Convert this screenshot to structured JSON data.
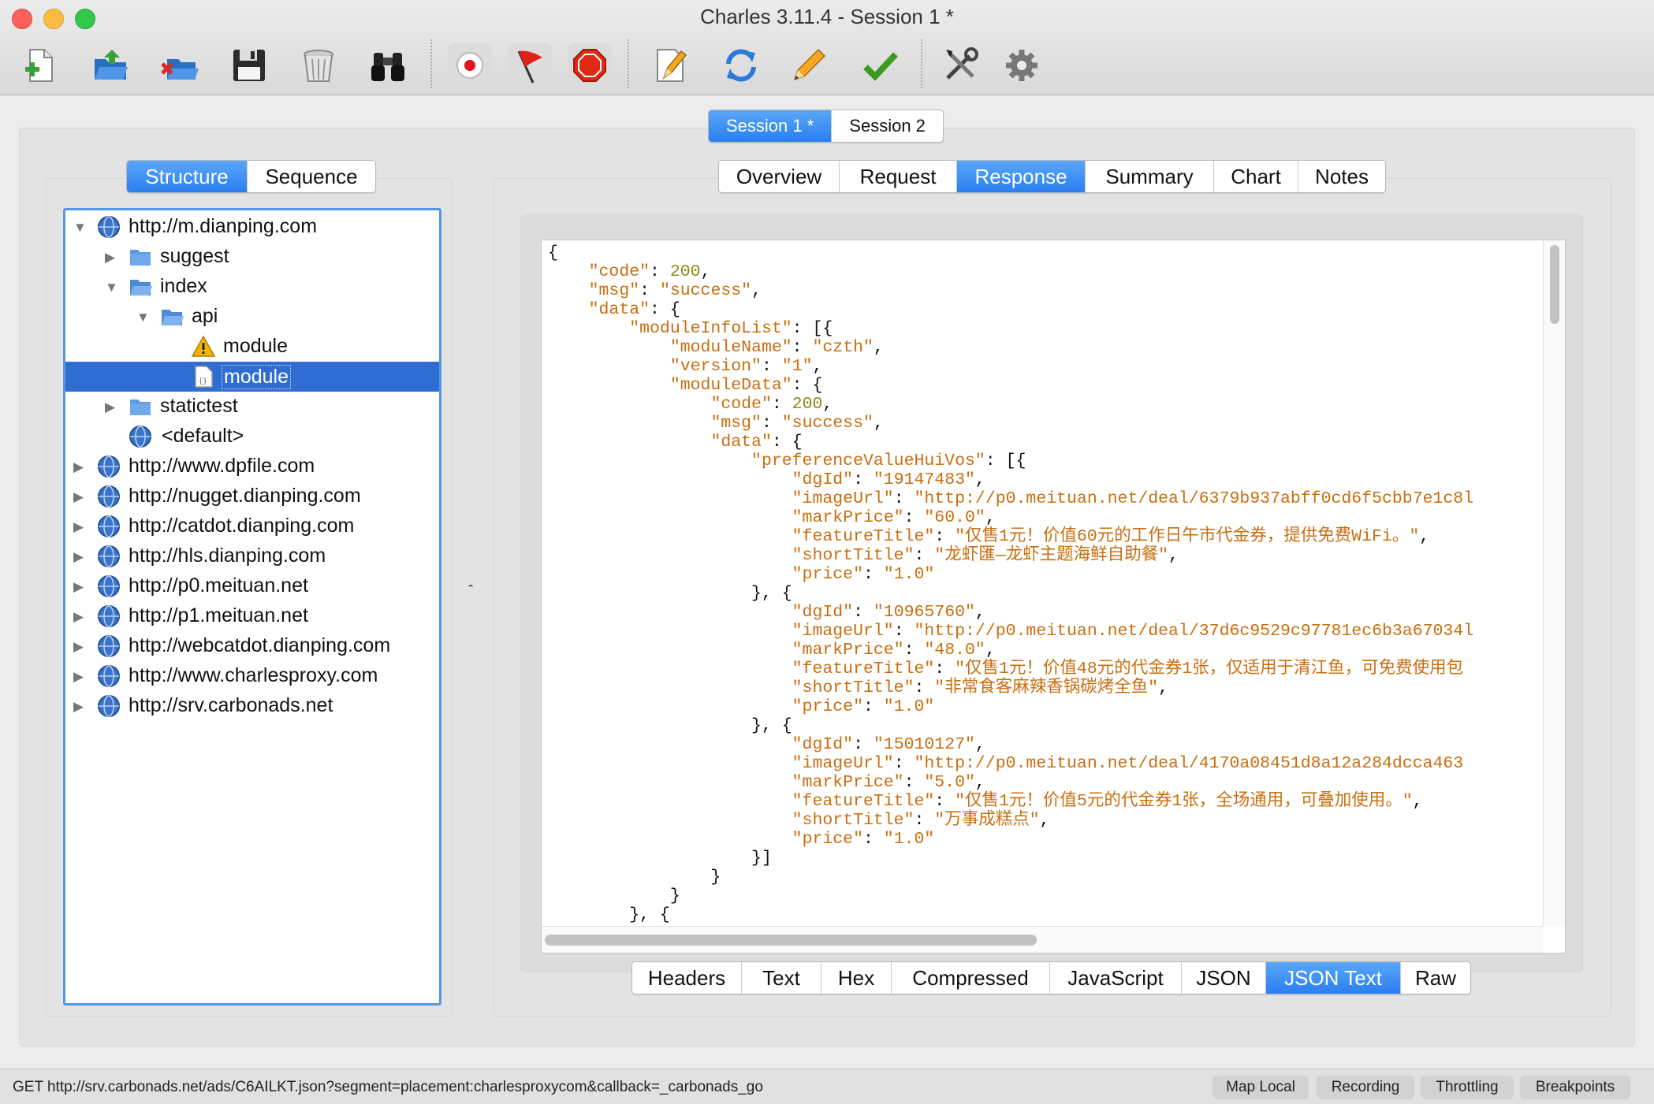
{
  "window": {
    "title": "Charles 3.11.4 - Session 1 *",
    "traffic_lights": {
      "close": "#fc605b",
      "minimize": "#fdbc40",
      "zoom": "#34c84a"
    }
  },
  "toolbar": {
    "buttons": [
      {
        "name": "new-session",
        "icon": "new-document-plus-icon"
      },
      {
        "name": "open-session",
        "icon": "open-folder-icon"
      },
      {
        "name": "close-session",
        "icon": "close-folder-icon"
      },
      {
        "name": "save-session",
        "icon": "floppy-disk-icon"
      },
      {
        "name": "clear-session",
        "icon": "trash-can-icon"
      },
      {
        "name": "find",
        "icon": "binoculars-icon"
      },
      {
        "name": "record",
        "icon": "record-icon"
      },
      {
        "name": "breakpoints",
        "icon": "red-flag-icon"
      },
      {
        "name": "throttle",
        "icon": "stop-sign-icon"
      },
      {
        "name": "compose",
        "icon": "compose-pencil-icon"
      },
      {
        "name": "repeat",
        "icon": "refresh-icon"
      },
      {
        "name": "edit",
        "icon": "pencil-icon"
      },
      {
        "name": "validate",
        "icon": "checkmark-icon"
      },
      {
        "name": "tools",
        "icon": "tools-icon"
      },
      {
        "name": "settings",
        "icon": "gear-icon"
      }
    ]
  },
  "session_tabs": [
    {
      "label": "Session 1 *",
      "selected": true
    },
    {
      "label": "Session 2",
      "selected": false
    }
  ],
  "view_tabs": [
    {
      "label": "Structure",
      "selected": true
    },
    {
      "label": "Sequence",
      "selected": false
    }
  ],
  "tree": [
    {
      "label": "http://m.dianping.com",
      "level": 0,
      "expanded": true,
      "icon": "globe-icon"
    },
    {
      "label": "suggest",
      "level": 1,
      "expanded": false,
      "icon": "folder-icon"
    },
    {
      "label": "index",
      "level": 1,
      "expanded": true,
      "icon": "folder-open-icon"
    },
    {
      "label": "api",
      "level": 2,
      "expanded": true,
      "icon": "folder-open-icon"
    },
    {
      "label": "module",
      "level": 3,
      "icon": "warning-icon"
    },
    {
      "label": "module",
      "level": 3,
      "icon": "json-file-icon",
      "selected": true
    },
    {
      "label": "statictest",
      "level": 1,
      "expanded": false,
      "icon": "folder-icon"
    },
    {
      "label": "<default>",
      "level": 1,
      "icon": "globe-icon"
    },
    {
      "label": "http://www.dpfile.com",
      "level": 0,
      "expanded": false,
      "icon": "globe-icon"
    },
    {
      "label": "http://nugget.dianping.com",
      "level": 0,
      "expanded": false,
      "icon": "globe-icon"
    },
    {
      "label": "http://catdot.dianping.com",
      "level": 0,
      "expanded": false,
      "icon": "globe-icon"
    },
    {
      "label": "http://hls.dianping.com",
      "level": 0,
      "expanded": false,
      "icon": "globe-icon"
    },
    {
      "label": "http://p0.meituan.net",
      "level": 0,
      "expanded": false,
      "icon": "globe-icon"
    },
    {
      "label": "http://p1.meituan.net",
      "level": 0,
      "expanded": false,
      "icon": "globe-icon"
    },
    {
      "label": "http://webcatdot.dianping.com",
      "level": 0,
      "expanded": false,
      "icon": "globe-icon"
    },
    {
      "label": "http://www.charlesproxy.com",
      "level": 0,
      "expanded": false,
      "icon": "globe-icon"
    },
    {
      "label": "http://srv.carbonads.net",
      "level": 0,
      "expanded": false,
      "icon": "globe-icon"
    }
  ],
  "detail_tabs": [
    {
      "label": "Overview",
      "selected": false
    },
    {
      "label": "Request",
      "selected": false
    },
    {
      "label": "Response",
      "selected": true
    },
    {
      "label": "Summary",
      "selected": false
    },
    {
      "label": "Chart",
      "selected": false
    },
    {
      "label": "Notes",
      "selected": false
    }
  ],
  "body_tabs": [
    {
      "label": "Headers",
      "selected": false
    },
    {
      "label": "Text",
      "selected": false
    },
    {
      "label": "Hex",
      "selected": false
    },
    {
      "label": "Compressed",
      "selected": false
    },
    {
      "label": "JavaScript",
      "selected": false
    },
    {
      "label": "JSON",
      "selected": false
    },
    {
      "label": "JSON Text",
      "selected": true
    },
    {
      "label": "Raw",
      "selected": false
    }
  ],
  "json_lines": [
    [
      {
        "t": "p",
        "v": "{"
      }
    ],
    [
      {
        "t": "p",
        "v": "    "
      },
      {
        "t": "k",
        "v": "\"code\""
      },
      {
        "t": "p",
        "v": ": "
      },
      {
        "t": "n",
        "v": "200"
      },
      {
        "t": "p",
        "v": ","
      }
    ],
    [
      {
        "t": "p",
        "v": "    "
      },
      {
        "t": "k",
        "v": "\"msg\""
      },
      {
        "t": "p",
        "v": ": "
      },
      {
        "t": "s",
        "v": "\"success\""
      },
      {
        "t": "p",
        "v": ","
      }
    ],
    [
      {
        "t": "p",
        "v": "    "
      },
      {
        "t": "k",
        "v": "\"data\""
      },
      {
        "t": "p",
        "v": ": {"
      }
    ],
    [
      {
        "t": "p",
        "v": "        "
      },
      {
        "t": "k",
        "v": "\"moduleInfoList\""
      },
      {
        "t": "p",
        "v": ": [{"
      }
    ],
    [
      {
        "t": "p",
        "v": "            "
      },
      {
        "t": "k",
        "v": "\"moduleName\""
      },
      {
        "t": "p",
        "v": ": "
      },
      {
        "t": "s",
        "v": "\"czth\""
      },
      {
        "t": "p",
        "v": ","
      }
    ],
    [
      {
        "t": "p",
        "v": "            "
      },
      {
        "t": "k",
        "v": "\"version\""
      },
      {
        "t": "p",
        "v": ": "
      },
      {
        "t": "s",
        "v": "\"1\""
      },
      {
        "t": "p",
        "v": ","
      }
    ],
    [
      {
        "t": "p",
        "v": "            "
      },
      {
        "t": "k",
        "v": "\"moduleData\""
      },
      {
        "t": "p",
        "v": ": {"
      }
    ],
    [
      {
        "t": "p",
        "v": "                "
      },
      {
        "t": "k",
        "v": "\"code\""
      },
      {
        "t": "p",
        "v": ": "
      },
      {
        "t": "n",
        "v": "200"
      },
      {
        "t": "p",
        "v": ","
      }
    ],
    [
      {
        "t": "p",
        "v": "                "
      },
      {
        "t": "k",
        "v": "\"msg\""
      },
      {
        "t": "p",
        "v": ": "
      },
      {
        "t": "s",
        "v": "\"success\""
      },
      {
        "t": "p",
        "v": ","
      }
    ],
    [
      {
        "t": "p",
        "v": "                "
      },
      {
        "t": "k",
        "v": "\"data\""
      },
      {
        "t": "p",
        "v": ": {"
      }
    ],
    [
      {
        "t": "p",
        "v": "                    "
      },
      {
        "t": "k",
        "v": "\"preferenceValueHuiVos\""
      },
      {
        "t": "p",
        "v": ": [{"
      }
    ],
    [
      {
        "t": "p",
        "v": "                        "
      },
      {
        "t": "k",
        "v": "\"dgId\""
      },
      {
        "t": "p",
        "v": ": "
      },
      {
        "t": "s",
        "v": "\"19147483\""
      },
      {
        "t": "p",
        "v": ","
      }
    ],
    [
      {
        "t": "p",
        "v": "                        "
      },
      {
        "t": "k",
        "v": "\"imageUrl\""
      },
      {
        "t": "p",
        "v": ": "
      },
      {
        "t": "s",
        "v": "\"http://p0.meituan.net/deal/6379b937abff0cd6f5cbb7e1c8l"
      }
    ],
    [
      {
        "t": "p",
        "v": "                        "
      },
      {
        "t": "k",
        "v": "\"markPrice\""
      },
      {
        "t": "p",
        "v": ": "
      },
      {
        "t": "s",
        "v": "\"60.0\""
      },
      {
        "t": "p",
        "v": ","
      }
    ],
    [
      {
        "t": "p",
        "v": "                        "
      },
      {
        "t": "k",
        "v": "\"featureTitle\""
      },
      {
        "t": "p",
        "v": ": "
      },
      {
        "t": "s",
        "v": "\"仅售1元！价值60元的工作日午市代金券，提供免费WiFi。\""
      },
      {
        "t": "p",
        "v": ","
      }
    ],
    [
      {
        "t": "p",
        "v": "                        "
      },
      {
        "t": "k",
        "v": "\"shortTitle\""
      },
      {
        "t": "p",
        "v": ": "
      },
      {
        "t": "s",
        "v": "\"龙虾匯—龙虾主题海鲜自助餐\""
      },
      {
        "t": "p",
        "v": ","
      }
    ],
    [
      {
        "t": "p",
        "v": "                        "
      },
      {
        "t": "k",
        "v": "\"price\""
      },
      {
        "t": "p",
        "v": ": "
      },
      {
        "t": "s",
        "v": "\"1.0\""
      }
    ],
    [
      {
        "t": "p",
        "v": "                    }, {"
      }
    ],
    [
      {
        "t": "p",
        "v": "                        "
      },
      {
        "t": "k",
        "v": "\"dgId\""
      },
      {
        "t": "p",
        "v": ": "
      },
      {
        "t": "s",
        "v": "\"10965760\""
      },
      {
        "t": "p",
        "v": ","
      }
    ],
    [
      {
        "t": "p",
        "v": "                        "
      },
      {
        "t": "k",
        "v": "\"imageUrl\""
      },
      {
        "t": "p",
        "v": ": "
      },
      {
        "t": "s",
        "v": "\"http://p0.meituan.net/deal/37d6c9529c97781ec6b3a67034l"
      }
    ],
    [
      {
        "t": "p",
        "v": "                        "
      },
      {
        "t": "k",
        "v": "\"markPrice\""
      },
      {
        "t": "p",
        "v": ": "
      },
      {
        "t": "s",
        "v": "\"48.0\""
      },
      {
        "t": "p",
        "v": ","
      }
    ],
    [
      {
        "t": "p",
        "v": "                        "
      },
      {
        "t": "k",
        "v": "\"featureTitle\""
      },
      {
        "t": "p",
        "v": ": "
      },
      {
        "t": "s",
        "v": "\"仅售1元！价值48元的代金券1张，仅适用于清江鱼，可免费使用包"
      }
    ],
    [
      {
        "t": "p",
        "v": "                        "
      },
      {
        "t": "k",
        "v": "\"shortTitle\""
      },
      {
        "t": "p",
        "v": ": "
      },
      {
        "t": "s",
        "v": "\"非常食客麻辣香锅碳烤全鱼\""
      },
      {
        "t": "p",
        "v": ","
      }
    ],
    [
      {
        "t": "p",
        "v": "                        "
      },
      {
        "t": "k",
        "v": "\"price\""
      },
      {
        "t": "p",
        "v": ": "
      },
      {
        "t": "s",
        "v": "\"1.0\""
      }
    ],
    [
      {
        "t": "p",
        "v": "                    }, {"
      }
    ],
    [
      {
        "t": "p",
        "v": "                        "
      },
      {
        "t": "k",
        "v": "\"dgId\""
      },
      {
        "t": "p",
        "v": ": "
      },
      {
        "t": "s",
        "v": "\"15010127\""
      },
      {
        "t": "p",
        "v": ","
      }
    ],
    [
      {
        "t": "p",
        "v": "                        "
      },
      {
        "t": "k",
        "v": "\"imageUrl\""
      },
      {
        "t": "p",
        "v": ": "
      },
      {
        "t": "s",
        "v": "\"http://p0.meituan.net/deal/4170a08451d8a12a284dcca463"
      }
    ],
    [
      {
        "t": "p",
        "v": "                        "
      },
      {
        "t": "k",
        "v": "\"markPrice\""
      },
      {
        "t": "p",
        "v": ": "
      },
      {
        "t": "s",
        "v": "\"5.0\""
      },
      {
        "t": "p",
        "v": ","
      }
    ],
    [
      {
        "t": "p",
        "v": "                        "
      },
      {
        "t": "k",
        "v": "\"featureTitle\""
      },
      {
        "t": "p",
        "v": ": "
      },
      {
        "t": "s",
        "v": "\"仅售1元！价值5元的代金券1张，全场通用，可叠加使用。\""
      },
      {
        "t": "p",
        "v": ","
      }
    ],
    [
      {
        "t": "p",
        "v": "                        "
      },
      {
        "t": "k",
        "v": "\"shortTitle\""
      },
      {
        "t": "p",
        "v": ": "
      },
      {
        "t": "s",
        "v": "\"万事成糕点\""
      },
      {
        "t": "p",
        "v": ","
      }
    ],
    [
      {
        "t": "p",
        "v": "                        "
      },
      {
        "t": "k",
        "v": "\"price\""
      },
      {
        "t": "p",
        "v": ": "
      },
      {
        "t": "s",
        "v": "\"1.0\""
      }
    ],
    [
      {
        "t": "p",
        "v": "                    }]"
      }
    ],
    [
      {
        "t": "p",
        "v": "                }"
      }
    ],
    [
      {
        "t": "p",
        "v": "            }"
      }
    ],
    [
      {
        "t": "p",
        "v": "        }, {"
      }
    ]
  ],
  "statusbar": {
    "url": "GET http://srv.carbonads.net/ads/C6AILKT.json?segment=placement:charlesproxycom&callback=_carbonads_go",
    "buttons": [
      "Map Local",
      "Recording",
      "Throttling",
      "Breakpoints"
    ]
  },
  "colors": {
    "selection_blue": "#2f6dd2",
    "segment_selected": "#2a7ef0",
    "json_key": "#c96e0f",
    "json_number": "#8d8a12"
  }
}
